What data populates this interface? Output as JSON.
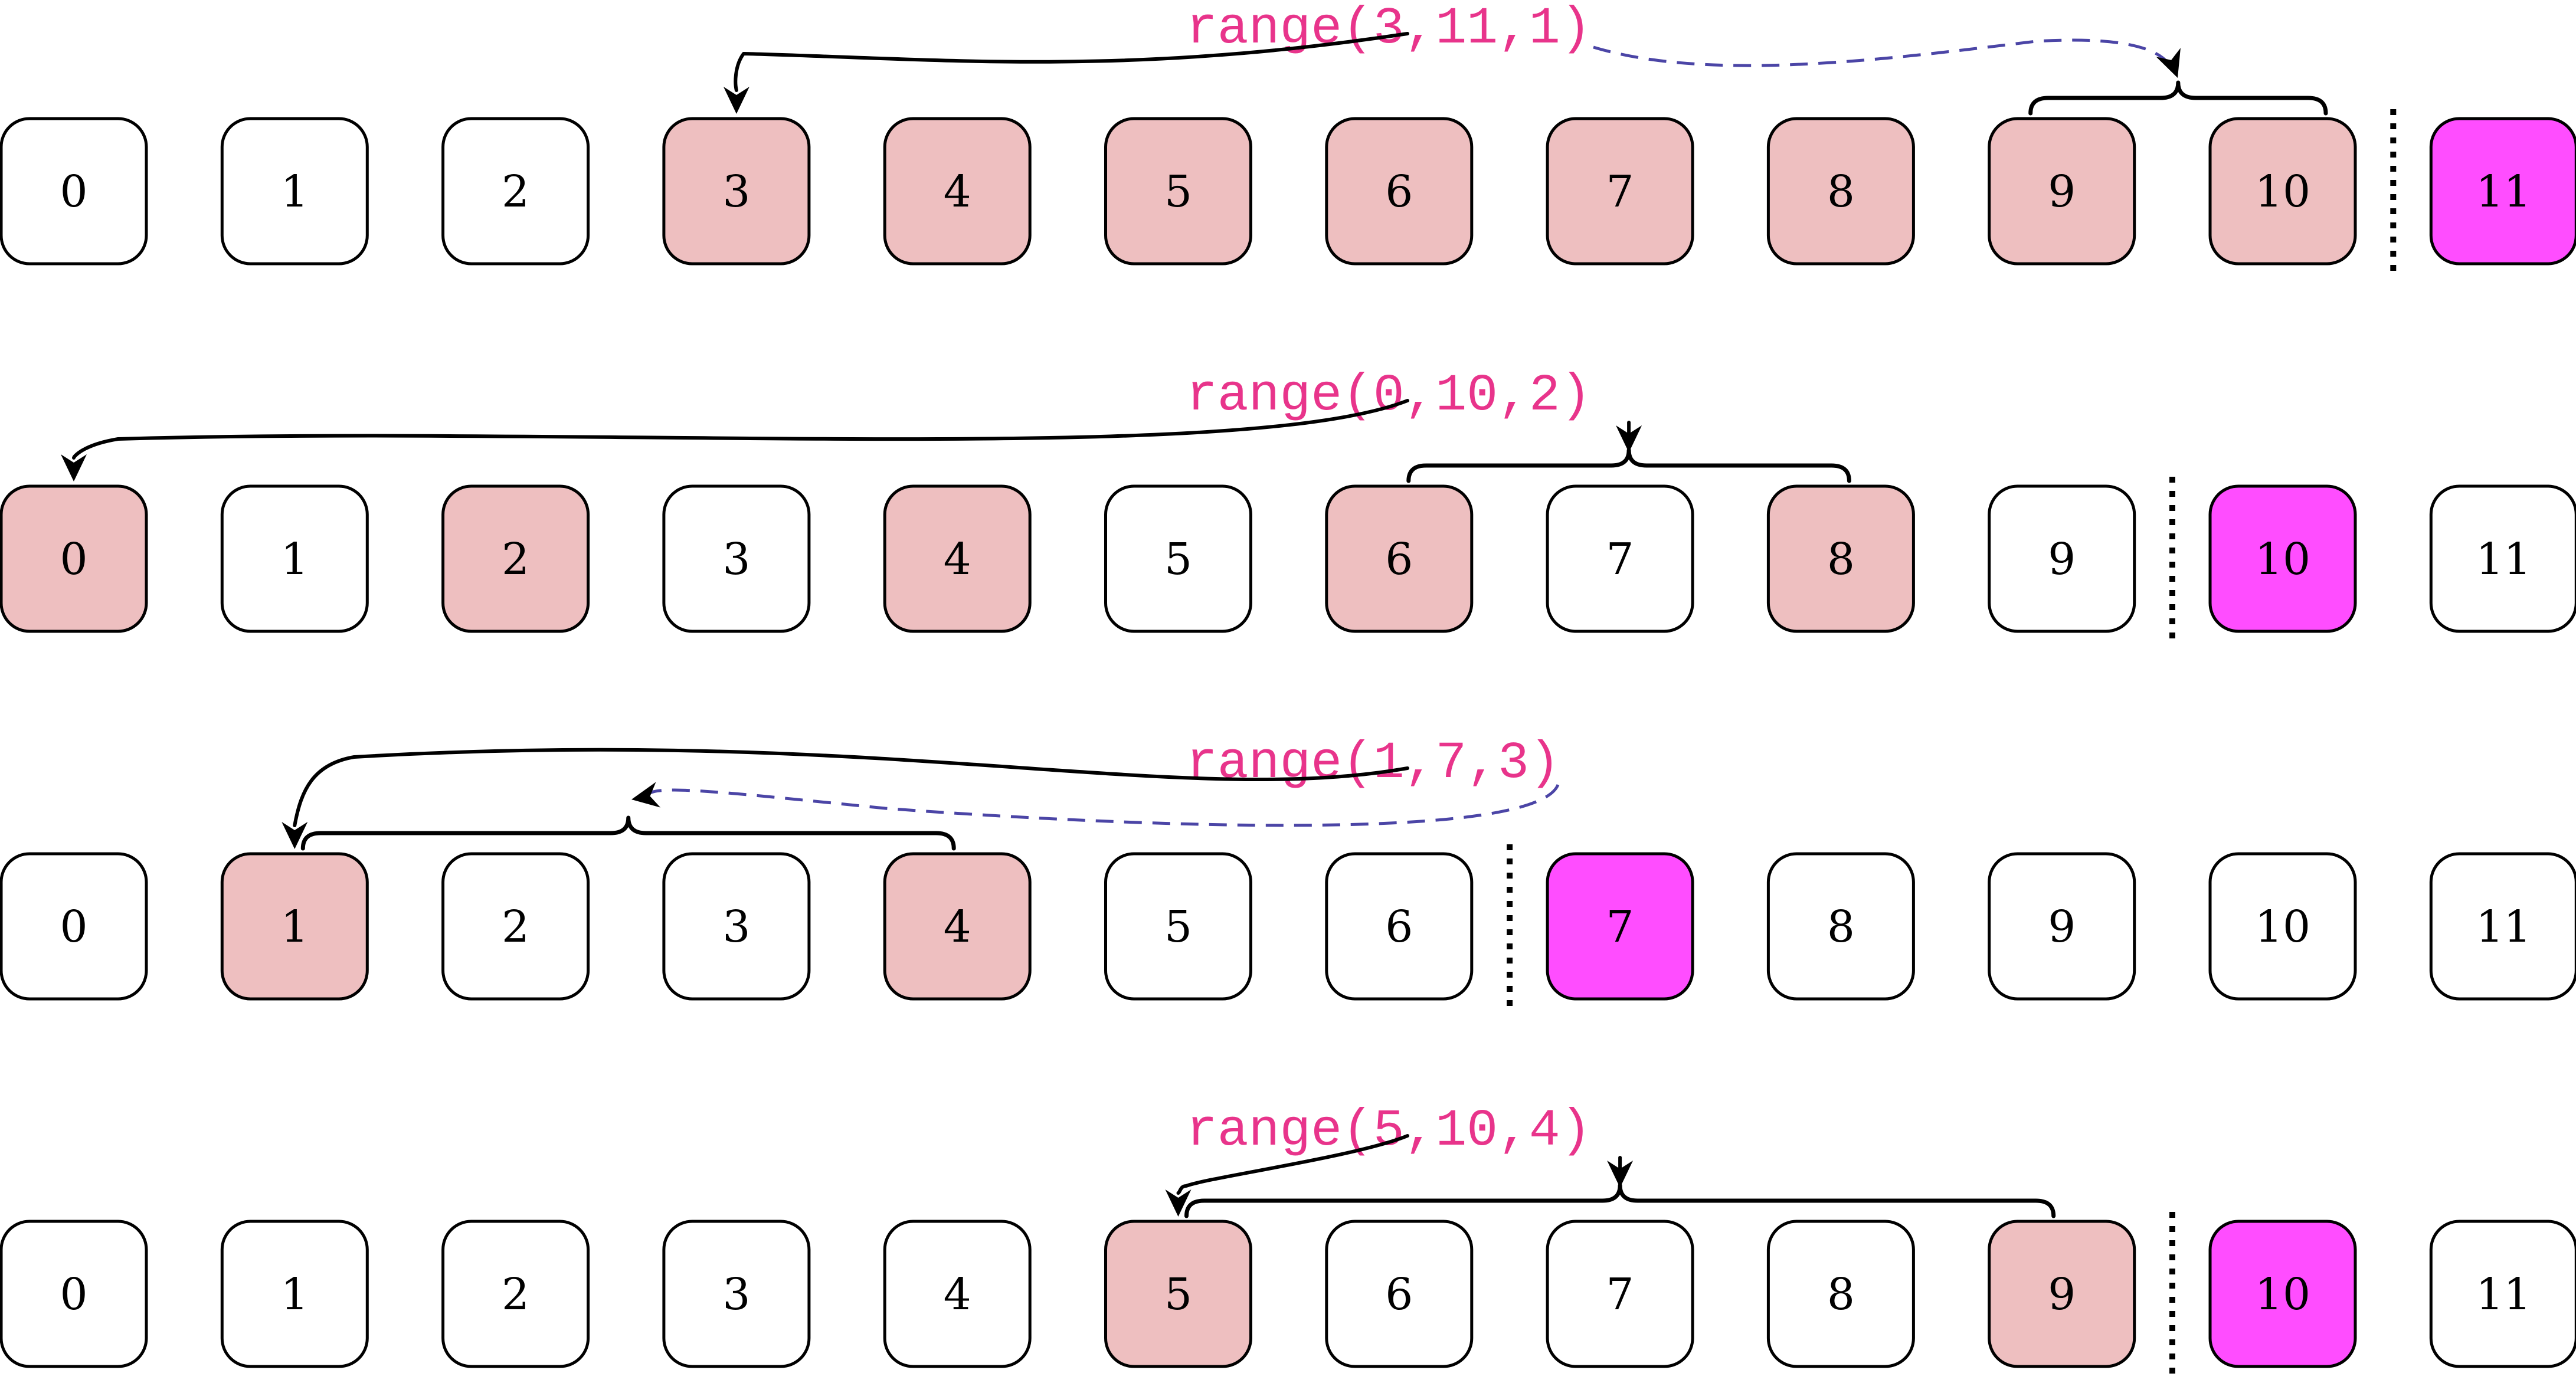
{
  "colors": {
    "selected": "#eebfc0",
    "stop": "#ff4dff",
    "unselected": "#ffffff",
    "call_text": "#e8348b",
    "step_link": "#4b45a6"
  },
  "rows": [
    {
      "label": "range(3,11,1)",
      "cells": [
        "0",
        "1",
        "2",
        "3",
        "4",
        "5",
        "6",
        "7",
        "8",
        "9",
        "10",
        "11"
      ],
      "start": 3,
      "stop": 11,
      "step": 1,
      "selected": [
        3,
        4,
        5,
        6,
        7,
        8,
        9,
        10
      ],
      "brace_cells": [
        9,
        10
      ],
      "start_arrow": "solid",
      "step_link": "dashed"
    },
    {
      "label": "range(0,10,2)",
      "cells": [
        "0",
        "1",
        "2",
        "3",
        "4",
        "5",
        "6",
        "7",
        "8",
        "9",
        "10",
        "11"
      ],
      "start": 0,
      "stop": 10,
      "step": 2,
      "selected": [
        0,
        2,
        4,
        6,
        8
      ],
      "brace_cells": [
        6,
        8
      ],
      "start_arrow": "solid",
      "step_link": "none"
    },
    {
      "label": "range(1,7,3)",
      "cells": [
        "0",
        "1",
        "2",
        "3",
        "4",
        "5",
        "6",
        "7",
        "8",
        "9",
        "10",
        "11"
      ],
      "start": 1,
      "stop": 7,
      "step": 3,
      "selected": [
        1,
        4
      ],
      "brace_cells": [
        1,
        4
      ],
      "start_arrow": "solid",
      "step_link": "dashed"
    },
    {
      "label": "range(5,10,4)",
      "cells": [
        "0",
        "1",
        "2",
        "3",
        "4",
        "5",
        "6",
        "7",
        "8",
        "9",
        "10",
        "11"
      ],
      "start": 5,
      "stop": 10,
      "step": 4,
      "selected": [
        5,
        9
      ],
      "brace_cells": [
        5,
        9
      ],
      "start_arrow": "solid",
      "step_link": "none"
    }
  ]
}
